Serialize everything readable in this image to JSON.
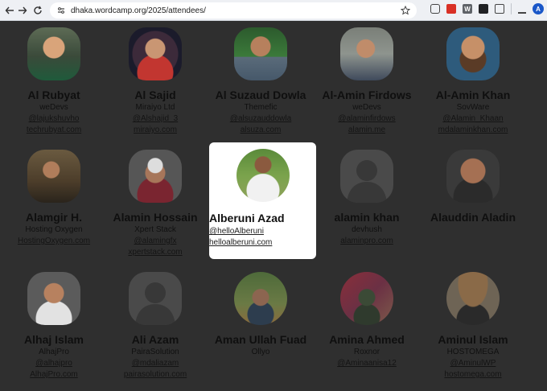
{
  "browser": {
    "url": "dhaka.wordcamp.org/2025/attendees/",
    "profile_initial": "A",
    "w_extension_letter": "W"
  },
  "attendees": [
    {
      "name": "Al Rubyat",
      "company": "weDevs",
      "handle": "@lajukshuvho",
      "site": "techrubyat.com"
    },
    {
      "name": "Al Sajid",
      "company": "Miraiyo Ltd",
      "handle": "@Alshajid_3",
      "site": "miraiyo.com"
    },
    {
      "name": "Al Suzaud Dowla",
      "company": "Themefic",
      "handle": "@alsuzauddowla",
      "site": "alsuza.com"
    },
    {
      "name": "Al-Amin Firdows",
      "company": "weDevs",
      "handle": "@alaminfirdows",
      "site": "alamin.me"
    },
    {
      "name": "Al-Amin Khan",
      "company": "SovWare",
      "handle": "@Alamin_Khaan",
      "site": "mdalaminkhan.com"
    },
    {
      "name": "Alamgir H.",
      "company": "Hosting Oxygen",
      "handle": "",
      "site": "HostingOxygen.com"
    },
    {
      "name": "Alamin Hossain",
      "company": "Xpert Stack",
      "handle": "@alamingfx",
      "site": "xpertstack.com"
    },
    {
      "name": "Alberuni Azad",
      "company": "",
      "handle": "@helloAlberuni",
      "site": "helloalberuni.com"
    },
    {
      "name": "alamin khan",
      "company": "devhush",
      "handle": "",
      "site": "alaminpro.com"
    },
    {
      "name": "Alauddin Aladin",
      "company": "",
      "handle": "",
      "site": ""
    },
    {
      "name": "Alhaj Islam",
      "company": "AlhajPro",
      "handle": "@alhajpro",
      "site": "AlhajPro.com"
    },
    {
      "name": "Ali Azam",
      "company": "PairaSolution",
      "handle": "@mdaliazam",
      "site": "pairasolution.com"
    },
    {
      "name": "Aman Ullah Fuad",
      "company": "Ollyo",
      "handle": "",
      "site": ""
    },
    {
      "name": "Amina Ahmed",
      "company": "Roxnor",
      "handle": "@Aminaanisa12",
      "site": ""
    },
    {
      "name": "Aminul Islam",
      "company": "HOSTOMEGA",
      "handle": "@AminulWP",
      "site": "hostomega.com"
    }
  ]
}
